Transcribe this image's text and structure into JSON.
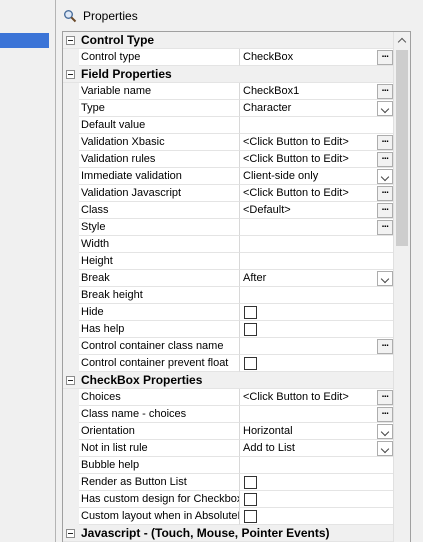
{
  "header": {
    "title": "Properties",
    "icon": "magnifier-icon"
  },
  "categories": {
    "control_type": "Control Type",
    "field_properties": "Field Properties",
    "checkbox_properties": "CheckBox Properties",
    "javascript": "Javascript - (Touch, Mouse, Pointer Events)"
  },
  "rows": {
    "control_type": {
      "name": "Control type",
      "value": "CheckBox"
    },
    "variable_name": {
      "name": "Variable name",
      "value": "CheckBox1"
    },
    "type": {
      "name": "Type",
      "value": "Character"
    },
    "default_value": {
      "name": "Default value",
      "value": ""
    },
    "validation_xbasic": {
      "name": "Validation Xbasic",
      "value": "<Click Button to Edit>"
    },
    "validation_rules": {
      "name": "Validation rules",
      "value": "<Click Button to Edit>"
    },
    "immediate_validation": {
      "name": "Immediate validation",
      "value": "Client-side only"
    },
    "validation_javascript": {
      "name": "Validation Javascript",
      "value": "<Click Button to Edit>"
    },
    "class": {
      "name": "Class",
      "value": "<Default>"
    },
    "style": {
      "name": "Style",
      "value": ""
    },
    "width": {
      "name": "Width",
      "value": ""
    },
    "height": {
      "name": "Height",
      "value": ""
    },
    "break": {
      "name": "Break",
      "value": "After"
    },
    "break_height": {
      "name": "Break height",
      "value": ""
    },
    "hide": {
      "name": "Hide"
    },
    "has_help": {
      "name": "Has help"
    },
    "container_class": {
      "name": "Control container class name",
      "value": ""
    },
    "container_float": {
      "name": "Control container prevent float"
    },
    "choices": {
      "name": "Choices",
      "value": "<Click Button to Edit>"
    },
    "class_choices": {
      "name": "Class name - choices",
      "value": ""
    },
    "orientation": {
      "name": "Orientation",
      "value": "Horizontal"
    },
    "not_in_list": {
      "name": "Not in list rule",
      "value": "Add to List"
    },
    "bubble_help": {
      "name": "Bubble help",
      "value": ""
    },
    "render_button_list": {
      "name": "Render as Button List"
    },
    "custom_design": {
      "name": "Has custom design for Checkbox"
    },
    "custom_layout": {
      "name": "Custom layout when in AbsoluteLa"
    }
  },
  "colors": {
    "selection": "#3b74d7",
    "category_bg": "#f0f0f0",
    "grid_bg": "#ffffff"
  }
}
